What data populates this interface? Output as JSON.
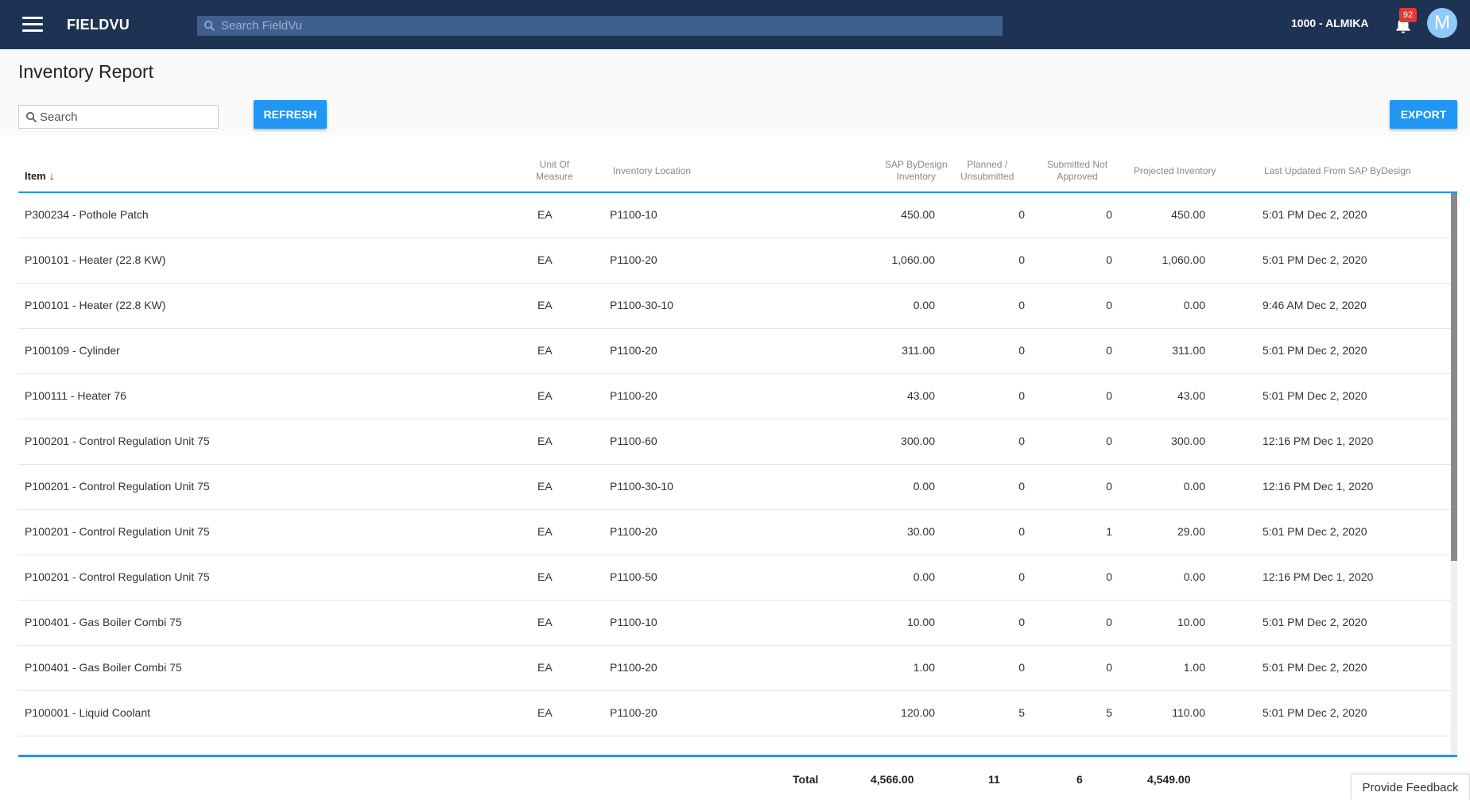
{
  "header": {
    "app_name": "FIELDVU",
    "search_placeholder": "Search FieldVu",
    "org": "1000 - ALMIKA",
    "notification_count": "92",
    "avatar_initial": "M"
  },
  "page": {
    "title": "Inventory Report",
    "search_placeholder": "Search",
    "refresh_label": "REFRESH",
    "export_label": "EXPORT"
  },
  "table": {
    "columns": {
      "item": "Item",
      "uom_line1": "Unit Of",
      "uom_line2": "Measure",
      "location": "Inventory Location",
      "sap_line1": "SAP ByDesign",
      "sap_line2": "Inventory",
      "planned_line1": "Planned /",
      "planned_line2": "Unsubmitted",
      "submitted_line1": "Submitted Not",
      "submitted_line2": "Approved",
      "projected": "Projected Inventory",
      "updated": "Last Updated From SAP ByDesign"
    },
    "rows": [
      {
        "item": "P300234 - Pothole Patch",
        "uom": "EA",
        "location": "P1100-10",
        "sap": "450.00",
        "planned": "0",
        "submitted": "0",
        "projected": "450.00",
        "updated": "5:01 PM Dec 2, 2020"
      },
      {
        "item": "P100101 - Heater (22.8 KW)",
        "uom": "EA",
        "location": "P1100-20",
        "sap": "1,060.00",
        "planned": "0",
        "submitted": "0",
        "projected": "1,060.00",
        "updated": "5:01 PM Dec 2, 2020"
      },
      {
        "item": "P100101 - Heater (22.8 KW)",
        "uom": "EA",
        "location": "P1100-30-10",
        "sap": "0.00",
        "planned": "0",
        "submitted": "0",
        "projected": "0.00",
        "updated": "9:46 AM Dec 2, 2020"
      },
      {
        "item": "P100109 - Cylinder",
        "uom": "EA",
        "location": "P1100-20",
        "sap": "311.00",
        "planned": "0",
        "submitted": "0",
        "projected": "311.00",
        "updated": "5:01 PM Dec 2, 2020"
      },
      {
        "item": "P100111 - Heater 76",
        "uom": "EA",
        "location": "P1100-20",
        "sap": "43.00",
        "planned": "0",
        "submitted": "0",
        "projected": "43.00",
        "updated": "5:01 PM Dec 2, 2020"
      },
      {
        "item": "P100201 - Control Regulation Unit 75",
        "uom": "EA",
        "location": "P1100-60",
        "sap": "300.00",
        "planned": "0",
        "submitted": "0",
        "projected": "300.00",
        "updated": "12:16 PM Dec 1, 2020"
      },
      {
        "item": "P100201 - Control Regulation Unit 75",
        "uom": "EA",
        "location": "P1100-30-10",
        "sap": "0.00",
        "planned": "0",
        "submitted": "0",
        "projected": "0.00",
        "updated": "12:16 PM Dec 1, 2020"
      },
      {
        "item": "P100201 - Control Regulation Unit 75",
        "uom": "EA",
        "location": "P1100-20",
        "sap": "30.00",
        "planned": "0",
        "submitted": "1",
        "projected": "29.00",
        "updated": "5:01 PM Dec 2, 2020"
      },
      {
        "item": "P100201 - Control Regulation Unit 75",
        "uom": "EA",
        "location": "P1100-50",
        "sap": "0.00",
        "planned": "0",
        "submitted": "0",
        "projected": "0.00",
        "updated": "12:16 PM Dec 1, 2020"
      },
      {
        "item": "P100401 - Gas Boiler Combi 75",
        "uom": "EA",
        "location": "P1100-10",
        "sap": "10.00",
        "planned": "0",
        "submitted": "0",
        "projected": "10.00",
        "updated": "5:01 PM Dec 2, 2020"
      },
      {
        "item": "P100401 - Gas Boiler Combi 75",
        "uom": "EA",
        "location": "P1100-20",
        "sap": "1.00",
        "planned": "0",
        "submitted": "0",
        "projected": "1.00",
        "updated": "5:01 PM Dec 2, 2020"
      },
      {
        "item": "P100001 - Liquid Coolant",
        "uom": "EA",
        "location": "P1100-20",
        "sap": "120.00",
        "planned": "5",
        "submitted": "5",
        "projected": "110.00",
        "updated": "5:01 PM Dec 2, 2020"
      }
    ],
    "totals": {
      "label": "Total",
      "sap": "4,566.00",
      "planned": "11",
      "submitted": "6",
      "projected": "4,549.00"
    }
  },
  "feedback_label": "Provide Feedback",
  "colors": {
    "topbar": "#1e3354",
    "accent": "#2196f3",
    "badge": "#e53935",
    "avatar": "#90caf9"
  }
}
